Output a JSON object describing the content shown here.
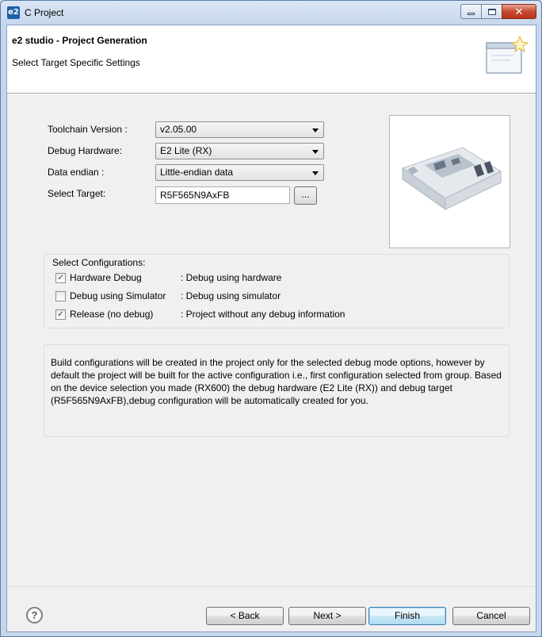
{
  "window": {
    "title": "C Project",
    "app_icon": "e2"
  },
  "caption_buttons": {
    "close": "✕"
  },
  "header": {
    "title": "e2 studio - Project Generation",
    "subtitle": "Select Target Specific Settings"
  },
  "form": {
    "toolchain_label": "Toolchain Version :",
    "toolchain_value": "v2.05.00",
    "debug_hw_label": "Debug Hardware:",
    "debug_hw_value": "E2 Lite (RX)",
    "endian_label": "Data endian :",
    "endian_value": "Little-endian data",
    "target_label": "Select Target:",
    "target_value": "R5F565N9AxFB",
    "browse_label": "..."
  },
  "configurations": {
    "title": "Select Configurations:",
    "items": [
      {
        "label": "Hardware Debug",
        "description": ": Debug using hardware",
        "checked": true,
        "mark": "✓"
      },
      {
        "label": "Debug using Simulator",
        "description": ": Debug using simulator",
        "checked": false,
        "mark": ""
      },
      {
        "label": "Release (no debug)",
        "description": ": Project without any debug information",
        "checked": true,
        "mark": "✓"
      }
    ]
  },
  "info": {
    "text": "Build configurations will be created in the project only for the selected debug mode options, however by default the project will be built for the active configuration i.e., first configuration selected from group. Based on the device selection you made (RX600) the debug hardware (E2 Lite (RX)) and debug target (R5F565N9AxFB),debug configuration will be automatically created for you."
  },
  "footer": {
    "help": "?",
    "back": "< Back",
    "next": "Next >",
    "finish": "Finish",
    "cancel": "Cancel"
  }
}
